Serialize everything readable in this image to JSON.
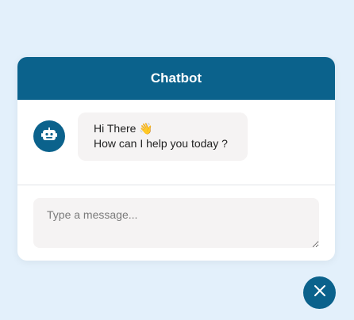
{
  "header": {
    "title": "Chatbot"
  },
  "messages": [
    {
      "sender": "bot",
      "line1": "Hi There",
      "emoji": "👋",
      "line2": "How can I help you today ?"
    }
  ],
  "input": {
    "placeholder": "Type a message...",
    "value": ""
  },
  "icons": {
    "avatar": "robot-icon",
    "close": "close-icon"
  },
  "colors": {
    "brand": "#0b628c",
    "background": "#e3f0fb",
    "bubble": "#f5f3f3"
  }
}
